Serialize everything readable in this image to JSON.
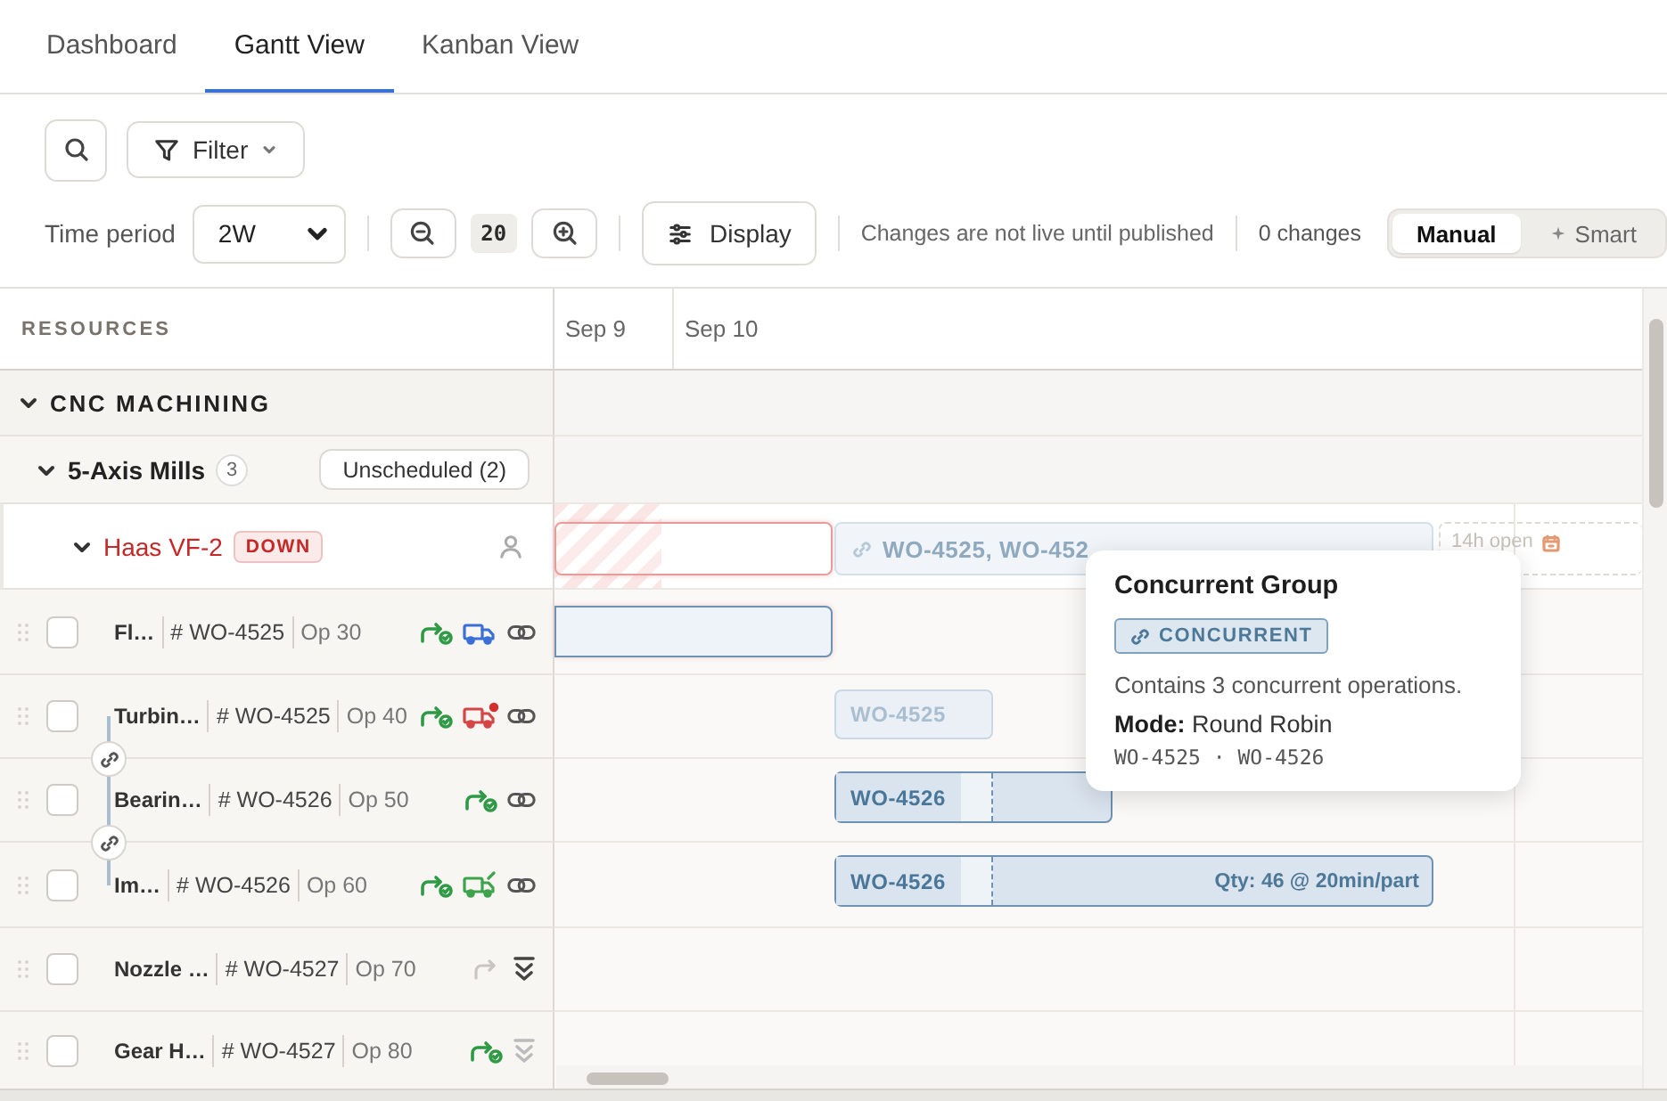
{
  "tabs": [
    {
      "label": "Dashboard",
      "selected": false
    },
    {
      "label": "Gantt View",
      "selected": true
    },
    {
      "label": "Kanban View",
      "selected": false
    }
  ],
  "toolbar": {
    "filter": "Filter",
    "time_period_label": "Time period",
    "time_period": "2W",
    "zoom": "20",
    "display": "Display",
    "notice": "Changes are not live until published",
    "changes": "0 changes",
    "modes": [
      {
        "label": "Manual",
        "kind": "plain",
        "selected": true
      },
      {
        "label": "Smart",
        "kind": "sparkle",
        "selected": false
      }
    ]
  },
  "resources_header": "RESOURCES",
  "timeline": {
    "dates": [
      "Sep 9",
      "Sep 10"
    ]
  },
  "groups": [
    {
      "name": "CNC MACHINING",
      "expanded": true,
      "children": [
        {
          "name": "5-Axis Mills",
          "count": "3",
          "unscheduled": "Unscheduled (2)",
          "expanded": true,
          "children": [
            {
              "name": "Haas VF-2",
              "status": "DOWN",
              "down": true,
              "expanded": true,
              "bars": [
                {
                  "kind": "down"
                },
                {
                  "kind": "group",
                  "label": "WO-4525, WO-452"
                },
                {
                  "kind": "open",
                  "label": "14h open"
                }
              ],
              "operations": [
                {
                  "name": "Fl…",
                  "work_order": "# WO-4525",
                  "op": "Op 30",
                  "checked": false,
                  "link_above": false,
                  "icons": [
                    {
                      "kind": "routed"
                    },
                    {
                      "kind": "truck",
                      "color": "#3b6fd8"
                    },
                    {
                      "kind": "link"
                    }
                  ],
                  "bars": [
                    {
                      "kind": "op"
                    }
                  ]
                },
                {
                  "name": "Turbin…",
                  "work_order": "# WO-4525",
                  "op": "Op 40",
                  "checked": false,
                  "link_above": false,
                  "icons": [
                    {
                      "kind": "routed"
                    },
                    {
                      "kind": "alerttruck",
                      "color": "#d64545"
                    },
                    {
                      "kind": "link"
                    }
                  ],
                  "bars": [
                    {
                      "kind": "faded",
                      "label": "WO-4525"
                    }
                  ]
                },
                {
                  "name": "Bearin…",
                  "work_order": "# WO-4526",
                  "op": "Op 50",
                  "checked": false,
                  "link_above": true,
                  "icons": [
                    {
                      "kind": "routed"
                    },
                    {
                      "kind": "link"
                    }
                  ],
                  "bars": [
                    {
                      "kind": "split",
                      "label": "WO-4526"
                    }
                  ]
                },
                {
                  "name": "Im…",
                  "work_order": "# WO-4526",
                  "op": "Op 60",
                  "checked": false,
                  "link_above": true,
                  "icons": [
                    {
                      "kind": "routed"
                    },
                    {
                      "kind": "flaggedtruck",
                      "color": "#3fa34d"
                    },
                    {
                      "kind": "link"
                    }
                  ],
                  "bars": [
                    {
                      "kind": "split",
                      "label": "WO-4526",
                      "note": "Qty: 46 @ 20min/part"
                    }
                  ]
                },
                {
                  "name": "Nozzle …",
                  "work_order": "# WO-4527",
                  "op": "Op 70",
                  "checked": false,
                  "link_above": false,
                  "icons": [
                    {
                      "kind": "unrouted"
                    },
                    {
                      "kind": "collapse"
                    }
                  ]
                },
                {
                  "name": "Gear H…",
                  "work_order": "# WO-4527",
                  "op": "Op 80",
                  "checked": false,
                  "link_above": false,
                  "icons": [
                    {
                      "kind": "routed"
                    },
                    {
                      "kind": "collapsefaint"
                    }
                  ]
                }
              ]
            }
          ]
        }
      ]
    }
  ],
  "tooltip": {
    "title": "Concurrent Group",
    "tag": "CONCURRENT",
    "description": "Contains 3 concurrent operations.",
    "mode": "**Mode:** Round Robin",
    "members": "WO-4525 · WO-4526"
  }
}
